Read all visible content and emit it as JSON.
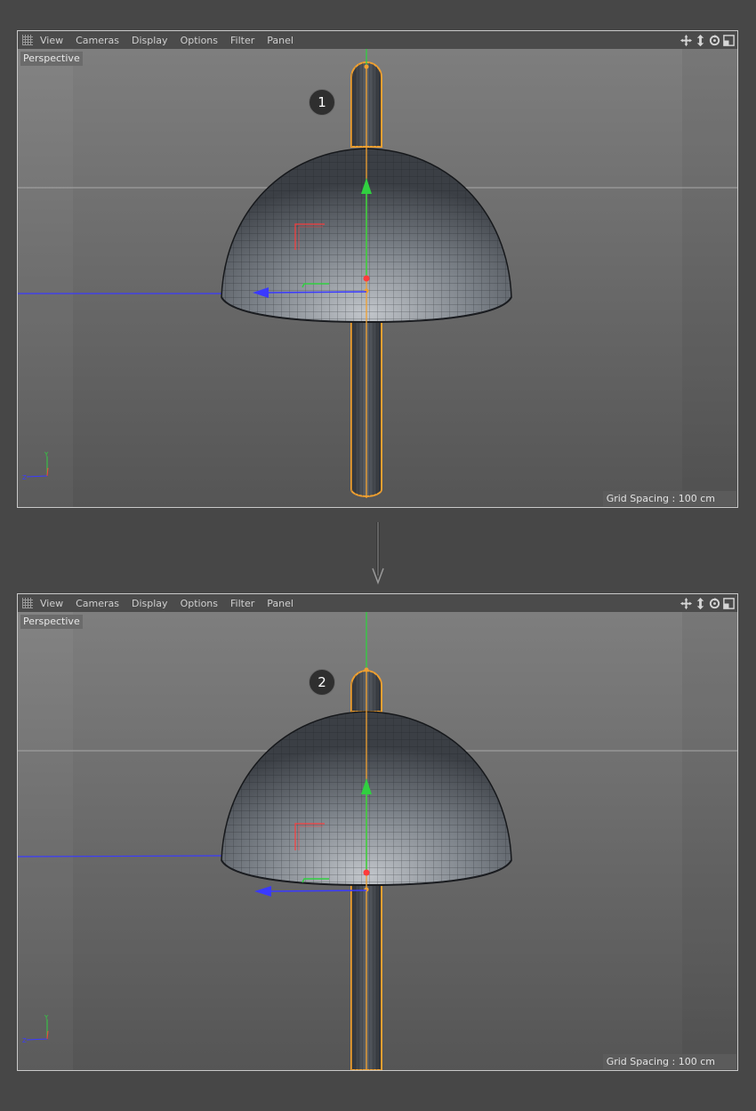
{
  "menu": {
    "items": [
      "View",
      "Cameras",
      "Display",
      "Options",
      "Filter",
      "Panel"
    ],
    "nav_icons": [
      "move-view-icon",
      "zoom-view-icon",
      "rotate-view-icon",
      "toggle-layout-icon"
    ]
  },
  "viewports": [
    {
      "camera": "Perspective",
      "step": "1",
      "grid_spacing": "Grid Spacing : 100 cm"
    },
    {
      "camera": "Perspective",
      "step": "2",
      "grid_spacing": "Grid Spacing : 100 cm"
    }
  ],
  "colors": {
    "selection": "#f0a030",
    "axis_x": "#ff3b3b",
    "axis_y": "#30d040",
    "axis_z": "#3a3aff",
    "mesh": "#3c4148"
  }
}
